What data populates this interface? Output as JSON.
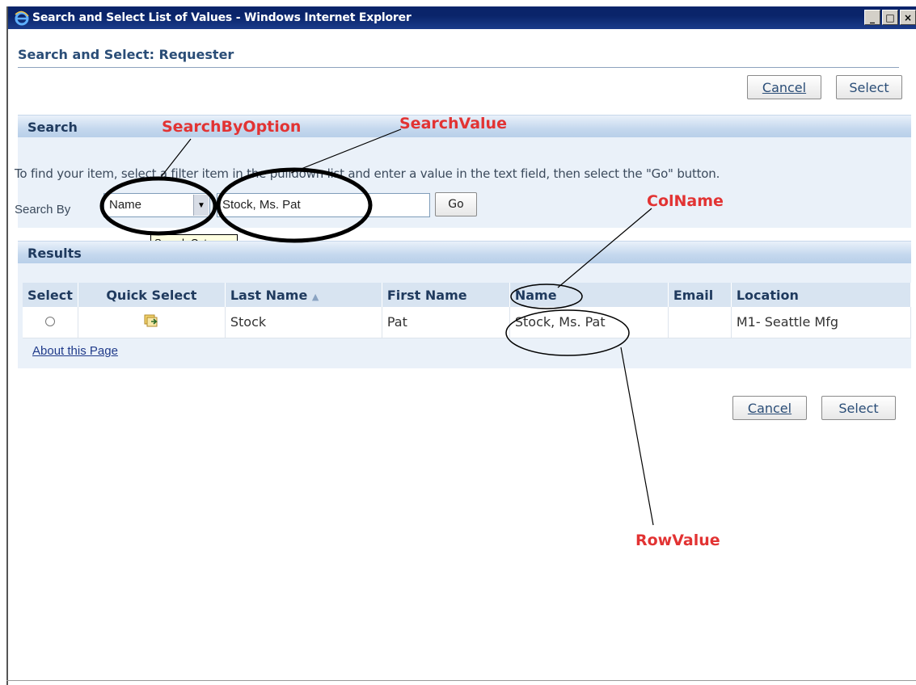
{
  "window": {
    "title": "Search and Select List of Values - Windows Internet Explorer",
    "min": "_",
    "max": "□",
    "close": "×"
  },
  "page": {
    "title": "Search and Select: Requester"
  },
  "buttons": {
    "cancel": "Cancel",
    "select": "Select",
    "go": "Go"
  },
  "search": {
    "section_title": "Search",
    "instructions": "To find your item, select a filter item in the pulldown list and enter a value in the text field, then select the \"Go\" button.",
    "search_by_label": "Search By",
    "search_by_value": "Name",
    "search_value": "Stock, Ms. Pat",
    "tooltip": "Search Category"
  },
  "results": {
    "section_title": "Results",
    "columns": [
      "Select",
      "Quick Select",
      "Last Name",
      "First Name",
      "Name",
      "Email",
      "Location"
    ],
    "rows": [
      {
        "last_name": "Stock",
        "first_name": "Pat",
        "name": "Stock, Ms. Pat",
        "email": "",
        "location": "M1- Seattle Mfg"
      }
    ],
    "about_link": "About this Page"
  },
  "annotations": {
    "search_by_option": "SearchByOption",
    "search_value": "SearchValue",
    "col_name": "ColName",
    "row_value": "RowValue"
  },
  "colors": {
    "annotation": "#e23333",
    "header_blue": "#2a4d77",
    "titlebar": "#0a246a"
  }
}
